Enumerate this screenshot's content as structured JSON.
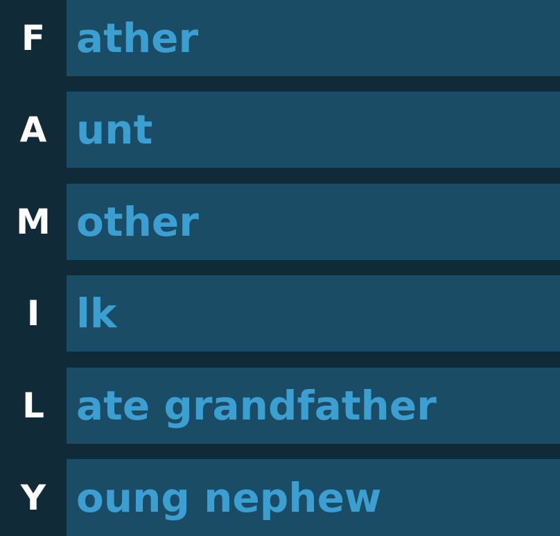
{
  "rows": [
    {
      "letter": "F",
      "rest": "ather"
    },
    {
      "letter": "A",
      "rest": "unt"
    },
    {
      "letter": "M",
      "rest": "other"
    },
    {
      "letter": "I",
      "rest": "lk"
    },
    {
      "letter": "L",
      "rest": "ate grandfather"
    },
    {
      "letter": "Y",
      "rest": "oung nephew"
    }
  ],
  "colors": {
    "background": "#102a38",
    "bar": "#1b4c65",
    "letter": "#ffffff",
    "word": "#3c9fd2"
  }
}
